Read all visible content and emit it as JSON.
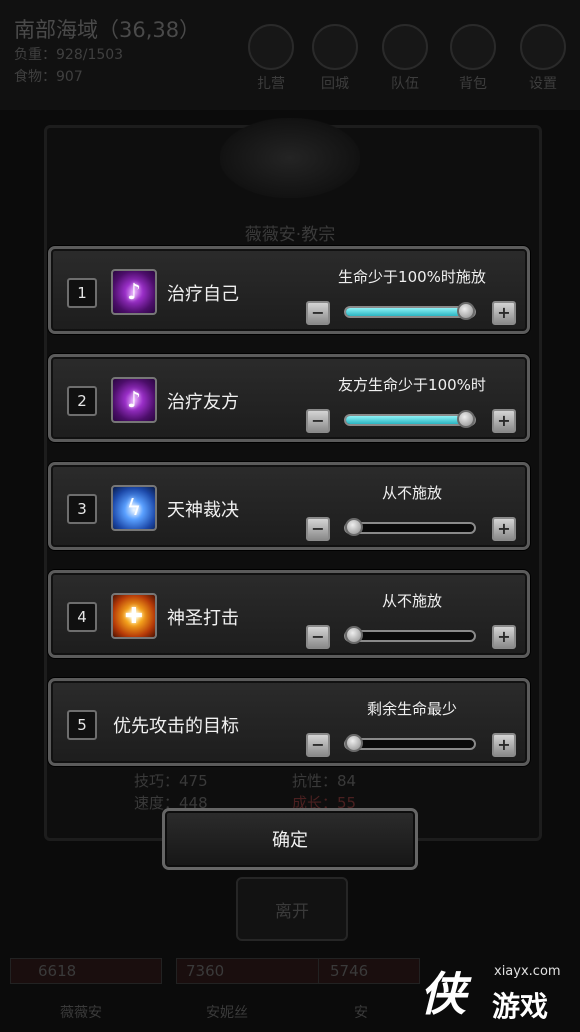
{
  "background": {
    "region_title": "南部海域（36,38）",
    "load": "负重：928/1503",
    "food": "食物：907",
    "top_menu": [
      {
        "label": "扎营",
        "icon": "camp-icon"
      },
      {
        "label": "回城",
        "icon": "return-town-icon"
      },
      {
        "label": "队伍",
        "icon": "team-icon"
      },
      {
        "label": "背包",
        "icon": "backpack-icon"
      },
      {
        "label": "设置",
        "icon": "gear-icon"
      }
    ],
    "character_name": "薇薇安·教宗",
    "attributes": [
      "技巧：475",
      "抗性：84",
      "速度：448",
      "成长：55"
    ],
    "leave_label": "离开",
    "bottom_numbers": [
      "6618",
      "7360",
      "5746"
    ],
    "bottom_names": [
      "薇薇安",
      "安妮丝",
      "安"
    ]
  },
  "skills": [
    {
      "index": "1",
      "name": "治疗自己",
      "condition": "生命少于100%时施放",
      "icon": "heal-icon",
      "value_percent": 100,
      "active": true
    },
    {
      "index": "2",
      "name": "治疗友方",
      "condition": "友方生命少于100%时",
      "icon": "heal-icon",
      "value_percent": 100,
      "active": true
    },
    {
      "index": "3",
      "name": "天神裁决",
      "condition": "从不施放",
      "icon": "lightning-icon",
      "value_percent": 0,
      "active": false
    },
    {
      "index": "4",
      "name": "神圣打击",
      "condition": "从不施放",
      "icon": "holy-strike-icon",
      "value_percent": 0,
      "active": false
    },
    {
      "index": "5",
      "name": "优先攻击的目标",
      "condition": "剩余生命最少",
      "icon": "",
      "value_percent": 0,
      "active": false
    }
  ],
  "controls": {
    "minus_symbol": "−",
    "plus_symbol": "+"
  },
  "confirm_label": "确定",
  "watermark": {
    "logo": "侠",
    "site": "xiayx.com",
    "text": "游戏"
  },
  "colors": {
    "slider_fill": "#2bb5c2",
    "panel_border": "#5b5b5b"
  }
}
